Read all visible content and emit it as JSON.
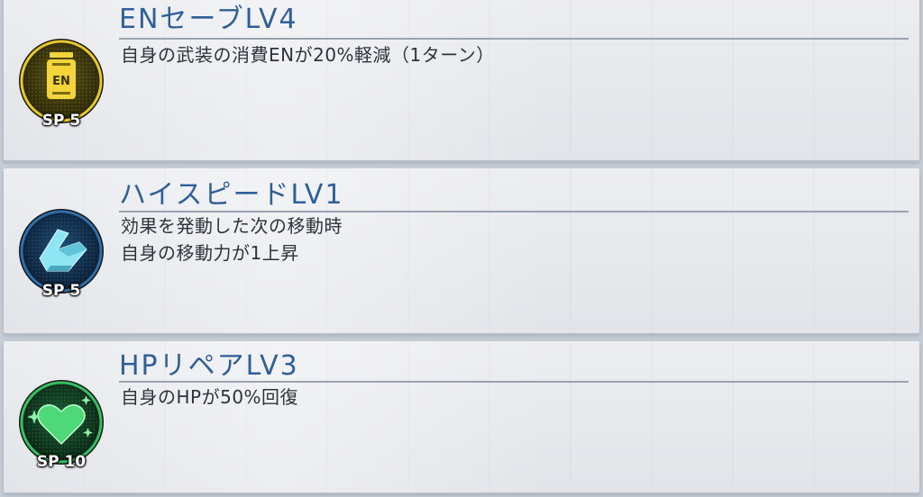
{
  "skills": [
    {
      "title": "ENセーブLV4",
      "description": [
        "自身の武装の消費ENが20%軽減（1ターン）"
      ],
      "sp_cost": "SP 5",
      "icon": "en-tank-icon",
      "icon_color": "#e6c62a"
    },
    {
      "title": "ハイスピードLV1",
      "description": [
        "効果を発動した次の移動時",
        "自身の移動力が1上昇"
      ],
      "sp_cost": "SP 5",
      "icon": "speed-thruster-icon",
      "icon_color": "#8ee6f2"
    },
    {
      "title": "HPリペアLV3",
      "description": [
        "自身のHPが50%回復"
      ],
      "sp_cost": "SP 10",
      "icon": "heart-repair-icon",
      "icon_color": "#4fd878"
    }
  ]
}
